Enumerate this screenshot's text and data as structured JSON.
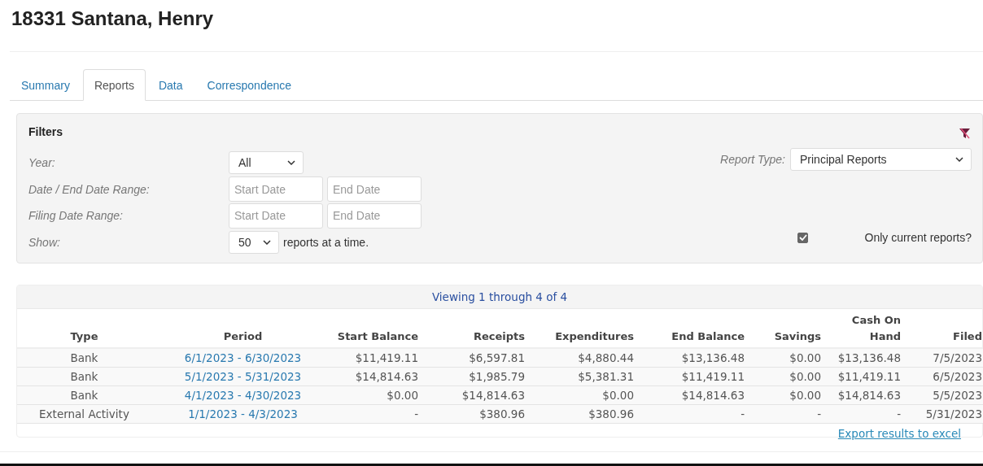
{
  "title": "18331 Santana, Henry",
  "tabs": [
    {
      "label": "Summary",
      "selected": false
    },
    {
      "label": "Reports",
      "selected": true
    },
    {
      "label": "Data",
      "selected": false
    },
    {
      "label": "Correspondence",
      "selected": false
    }
  ],
  "filters": {
    "heading": "Filters",
    "fields": [
      {
        "kind": "select",
        "label": "Year:",
        "value": "All"
      },
      {
        "kind": "date_range",
        "label": "Date / End Date Range:",
        "start_placeholder": "Start Date",
        "end_placeholder": "End Date"
      },
      {
        "kind": "date_range",
        "label": "Filing Date Range:",
        "start_placeholder": "Start Date",
        "end_placeholder": "End Date"
      },
      {
        "kind": "select",
        "label": "Show:",
        "value": "50",
        "suffix": "reports at a time."
      }
    ],
    "report_type": {
      "label": "Report Type:",
      "value": "Principal Reports"
    },
    "only_current": {
      "label": "Only current reports?",
      "checked": true
    }
  },
  "table": {
    "caption": "Viewing 1 through 4 of 4",
    "columns": [
      "Type",
      "Period",
      "Start Balance",
      "Receipts",
      "Expenditures",
      "End Balance",
      "Savings",
      "Cash On Hand",
      "Filed"
    ],
    "rows": [
      [
        "Bank",
        "6/1/2023 - 6/30/2023",
        "$11,419.11",
        "$6,597.81",
        "$4,880.44",
        "$13,136.48",
        "$0.00",
        "$13,136.48",
        "7/5/2023"
      ],
      [
        "Bank",
        "5/1/2023 - 5/31/2023",
        "$14,814.63",
        "$1,985.79",
        "$5,381.31",
        "$11,419.11",
        "$0.00",
        "$11,419.11",
        "6/5/2023"
      ],
      [
        "Bank",
        "4/1/2023 - 4/30/2023",
        "$0.00",
        "$14,814.63",
        "$0.00",
        "$14,814.63",
        "$0.00",
        "$14,814.63",
        "5/5/2023"
      ],
      [
        "External Activity",
        "1/1/2023 - 4/3/2023",
        "-",
        "$380.96",
        "$380.96",
        "-",
        "-",
        "-",
        "5/31/2023"
      ]
    ],
    "export_link": "Export results to excel"
  }
}
